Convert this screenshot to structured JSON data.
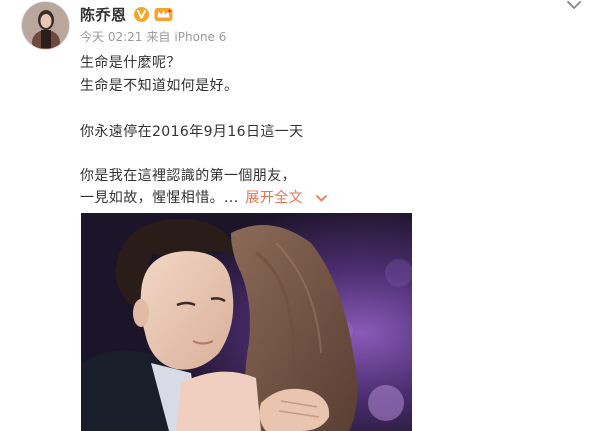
{
  "post": {
    "username": "陈乔恩",
    "time": "今天 02:21",
    "source_prefix": "来自",
    "source_device": "iPhone 6",
    "lines": [
      "生命是什麼呢？",
      "生命是不知道如何是好。",
      "",
      "你永遠停在2016年9月16日這一天",
      "",
      "你是我在這裡認識的第一個朋友，",
      "一見如故，惺惺相惜。..."
    ],
    "expand_label": "展开全文",
    "icons": {
      "verified": "verified-v-icon",
      "vip": "vip-crown-icon",
      "menu": "chevron-down-icon",
      "expand": "expand-chevron-icon"
    },
    "colors": {
      "accent": "#eb7350",
      "verified": "#f5a623",
      "meta": "#999999",
      "text": "#333333"
    }
  }
}
